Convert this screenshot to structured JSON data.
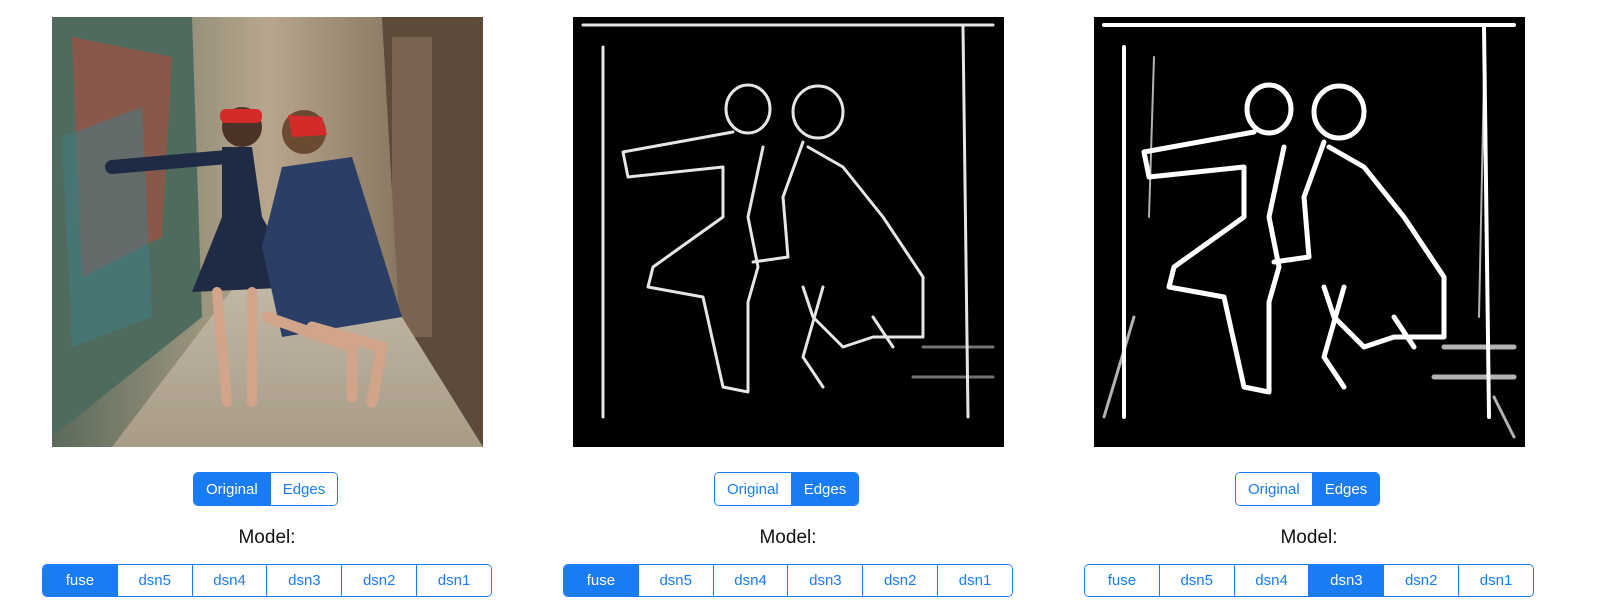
{
  "panels": [
    {
      "view": "Original",
      "toggle": {
        "original_label": "Original",
        "edges_label": "Edges",
        "active": "Original"
      },
      "model_label": "Model:",
      "models": [
        "fuse",
        "dsn5",
        "dsn4",
        "dsn3",
        "dsn2",
        "dsn1"
      ],
      "active_model": "fuse"
    },
    {
      "view": "Edges",
      "toggle": {
        "original_label": "Original",
        "edges_label": "Edges",
        "active": "Edges"
      },
      "model_label": "Model:",
      "models": [
        "fuse",
        "dsn5",
        "dsn4",
        "dsn3",
        "dsn2",
        "dsn1"
      ],
      "active_model": "fuse"
    },
    {
      "view": "Edges",
      "toggle": {
        "original_label": "Original",
        "edges_label": "Edges",
        "active": "Edges"
      },
      "model_label": "Model:",
      "models": [
        "fuse",
        "dsn5",
        "dsn4",
        "dsn3",
        "dsn2",
        "dsn1"
      ],
      "active_model": "dsn3"
    }
  ],
  "colors": {
    "accent": "#1a7cf5",
    "edge_background": "#000000",
    "edge_stroke": "#ffffff"
  }
}
